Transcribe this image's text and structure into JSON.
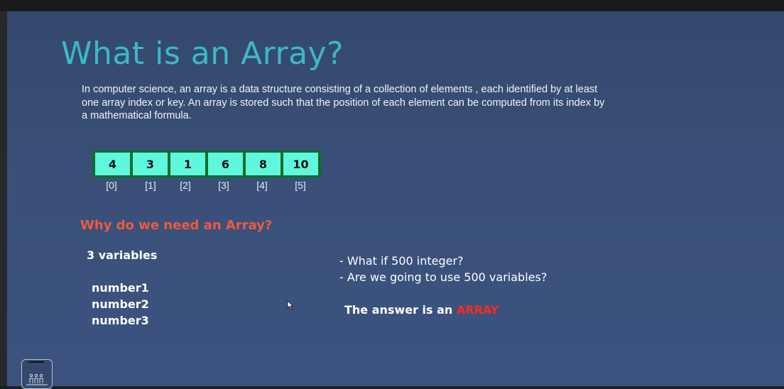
{
  "slide": {
    "title": "What is an Array?",
    "intro": "In computer science, an array  is a data structure consisting of a collection of elements , each identified by at least one array index or key. An array is stored such that the position of each element can be computed from its index by a mathematical formula.",
    "array": {
      "values": [
        "4",
        "3",
        "1",
        "6",
        "8",
        "10"
      ],
      "indices": [
        "[0]",
        "[1]",
        "[2]",
        "[3]",
        "[4]",
        "[5]"
      ]
    },
    "why_heading": "Why do we need an Array?",
    "variables_title": "3 variables",
    "variables": [
      "number1",
      "number2",
      "number3"
    ],
    "questions": [
      "- What if 500 integer?",
      "- Are we going to use 500 variables?"
    ],
    "answer_prefix": "The answer is an ",
    "answer_highlight": "ARRAY"
  },
  "colors": {
    "title": "#3cb8c8",
    "heading": "#ef5a3f",
    "highlight": "#ff2a1e",
    "cell": "#5ff7dd",
    "cell_border": "#0f6d2a",
    "background": "#3a5079"
  }
}
